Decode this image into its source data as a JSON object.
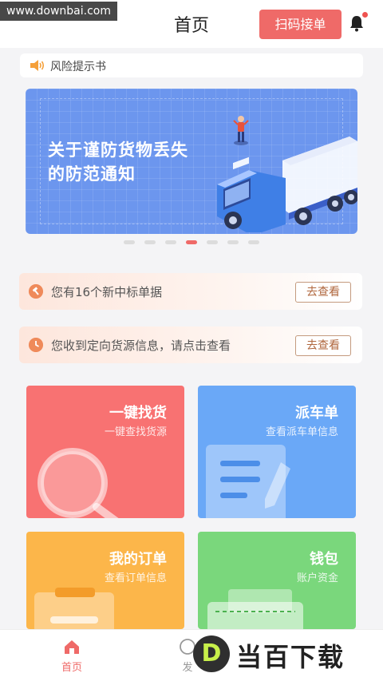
{
  "watermark": "www.downbai.com",
  "header": {
    "title": "首页",
    "scan_button": "扫码接单"
  },
  "notice": {
    "text": "风险提示书"
  },
  "banner": {
    "line1": "关于谨防货物丢失",
    "line2": "的防范通知",
    "active_dot": 3,
    "dot_count": 7
  },
  "alerts": [
    {
      "text": "您有16个新中标单据",
      "button": "去查看"
    },
    {
      "text": "您收到定向货源信息，请点击查看",
      "button": "去查看"
    }
  ],
  "cards": [
    {
      "title": "一键找货",
      "subtitle": "一键查找货源",
      "color": "#f87272"
    },
    {
      "title": "派车单",
      "subtitle": "查看派车单信息",
      "color": "#6aa8f7"
    },
    {
      "title": "我的订单",
      "subtitle": "查看订单信息",
      "color": "#fcb64a"
    },
    {
      "title": "钱包",
      "subtitle": "账户资金",
      "color": "#7ad77c"
    }
  ],
  "tabs": [
    {
      "label": "首页"
    },
    {
      "label": "发"
    }
  ],
  "brand_logo": {
    "letter": "D",
    "text": "当百下载"
  },
  "colors": {
    "accent": "#ef6a68"
  }
}
